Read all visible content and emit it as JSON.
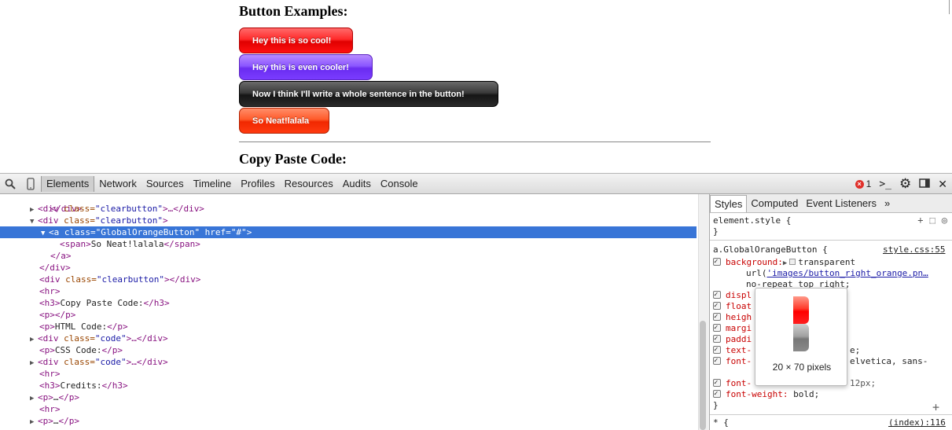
{
  "page": {
    "heading1": "Button Examples:",
    "buttons": [
      "Hey this is so cool!",
      "Hey this is even cooler!",
      "Now I think I'll write a whole sentence in the button!",
      "So Neat!lalala"
    ],
    "heading2": "Copy Paste Code:"
  },
  "devtools": {
    "tabs": [
      "Elements",
      "Network",
      "Sources",
      "Timeline",
      "Profiles",
      "Resources",
      "Audits",
      "Console"
    ],
    "active_tab": "Elements",
    "error_count": "1",
    "colors": {
      "selection": "#3875d7",
      "tag": "#881280",
      "attr": "#994500",
      "value": "#1a1aa6",
      "prop": "#c80000"
    }
  },
  "dom": {
    "lines": [
      {
        "tri": "",
        "tag1": "</div>",
        "a1": "",
        "v1": "",
        "rest": ""
      },
      {
        "tri": "▶",
        "tag1": "<div",
        "a1": " class=",
        "v1": "\"clearbutton\"",
        "rest": ">…</div>"
      },
      {
        "tri": "▼",
        "tag1": "<div",
        "a1": " class=",
        "v1": "\"clearbutton\"",
        "rest": ">"
      },
      {
        "tri": "▼",
        "tag1": "<a",
        "a1": " class=",
        "v1": "\"GlobalOrangeButton\"",
        "a2": " href=",
        "v2": "\"#\"",
        "rest": ">"
      },
      {
        "tri": "",
        "tag1": "<span>",
        "text": "So Neat!lalala",
        "tag2": "</span>"
      },
      {
        "tri": "",
        "tag1": "</a>"
      },
      {
        "tri": "",
        "tag1": "</div>"
      },
      {
        "tri": "",
        "tag1": "<div",
        "a1": " class=",
        "v1": "\"clearbutton\"",
        "rest": "></div>"
      },
      {
        "tri": "",
        "tag1": "<hr>"
      },
      {
        "tri": "",
        "tag1": "<h3>",
        "text": "Copy Paste Code:",
        "tag2": "</h3>"
      },
      {
        "tri": "",
        "tag1": "<p>",
        "text": "",
        "tag2": "</p>"
      },
      {
        "tri": "",
        "tag1": "<p>",
        "text": "HTML Code:",
        "tag2": "</p>"
      },
      {
        "tri": "▶",
        "tag1": "<div",
        "a1": " class=",
        "v1": "\"code\"",
        "rest": ">…</div>"
      },
      {
        "tri": "",
        "tag1": "<p>",
        "text": "CSS Code:",
        "tag2": "</p>"
      },
      {
        "tri": "▶",
        "tag1": "<div",
        "a1": " class=",
        "v1": "\"code\"",
        "rest": ">…</div>"
      },
      {
        "tri": "",
        "tag1": "<hr>"
      },
      {
        "tri": "",
        "tag1": "<h3>",
        "text": "Credits:",
        "tag2": "</h3>"
      },
      {
        "tri": "▶",
        "tag1": "<p>",
        "text": "…",
        "tag2": "</p>"
      },
      {
        "tri": "",
        "tag1": "<hr>"
      },
      {
        "tri": "▶",
        "tag1": "<p>",
        "text": "…",
        "tag2": "</p>"
      }
    ]
  },
  "styles": {
    "tabs": [
      "Styles",
      "Computed",
      "Event Listeners"
    ],
    "more": "»",
    "element_style": "element.style {",
    "close_brace": "}",
    "rule_selector": "a.GlobalOrangeButton {",
    "rule_source": "style.css:55",
    "background_prop": "background:",
    "background_val1": "transparent",
    "background_url_fn": "url(",
    "background_url": "'images/button_right_orange.pn…",
    "background_val3": "no-repeat top right;",
    "props_partial": [
      "displ",
      "float",
      "heigh",
      "margi",
      "paddi",
      "text-",
      "font-"
    ],
    "text_tail": "e;",
    "font_tail": "elvetica, sans-",
    "font_tail2": "se",
    "font_size_prop": "font-",
    "font_size_tail": "12px;",
    "font_weight_prop": "font-weight:",
    "font_weight_val": "bold;",
    "star_rule": "* {",
    "star_source": "(index):116"
  },
  "tooltip": {
    "size": "20 × 70 pixels"
  }
}
